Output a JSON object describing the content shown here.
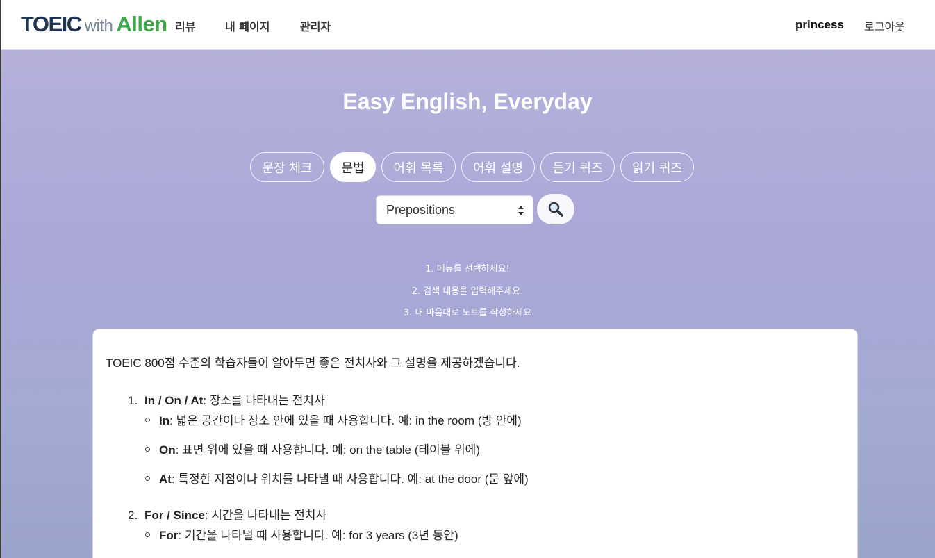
{
  "nav": {
    "brand": {
      "part1": "TOEIC",
      "part2": "with",
      "part3": "Allen"
    },
    "links": [
      "리뷰",
      "내 페이지",
      "관리자"
    ],
    "user": "princess",
    "logout": "로그아웃"
  },
  "hero": {
    "title": "Easy English, Everyday",
    "tabs": [
      "문장 체크",
      "문법",
      "어휘 목록",
      "어휘 설명",
      "듣기 퀴즈",
      "읽기 퀴즈"
    ],
    "active_tab": "문법",
    "select_value": "Prepositions",
    "search_icon": "magnifier-icon",
    "steps": [
      "1. 메뉴를 선택하세요!",
      "2. 검색 내용을 입력해주세요.",
      "3. 내 마음대로 노트를 작성하세요"
    ]
  },
  "content": {
    "intro": "TOEIC 800점 수준의 학습자들이 알아두면 좋은 전치사와 그 설명을 제공하겠습니다.",
    "items": [
      {
        "num": "1.",
        "term": "In / On / At",
        "desc": ": 장소를 나타내는 전치사",
        "bullets": [
          {
            "term": "In",
            "text": ": 넓은 공간이나 장소 안에 있을 때 사용합니다. 예: in the room (방 안에)"
          },
          {
            "term": "On",
            "text": ": 표면 위에 있을 때 사용합니다. 예: on the table (테이블 위에)"
          },
          {
            "term": "At",
            "text": ": 특정한 지점이나 위치를 나타낼 때 사용합니다. 예: at the door (문 앞에)"
          }
        ]
      },
      {
        "num": "2.",
        "term": "For / Since",
        "desc": ": 시간을 나타내는 전치사",
        "bullets": [
          {
            "term": "For",
            "text": ": 기간을 나타낼 때 사용합니다. 예: for 3 years (3년 동안)"
          }
        ]
      }
    ]
  },
  "colors": {
    "brand_navy": "#1f3551",
    "brand_green": "#3fa64a",
    "brand_gray": "#7b8799"
  }
}
